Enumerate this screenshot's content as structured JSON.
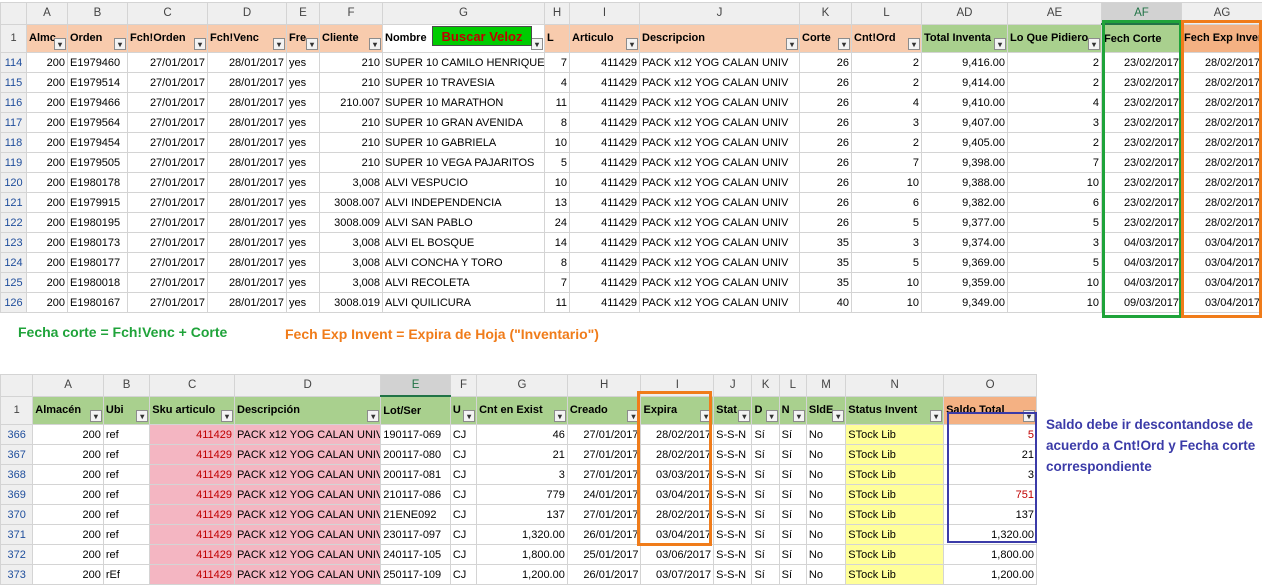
{
  "sheet1": {
    "col_letters": [
      "",
      "A",
      "B",
      "C",
      "D",
      "E",
      "F",
      "G",
      "H",
      "I",
      "J",
      "K",
      "L",
      "AD",
      "AE",
      "AF",
      "AG"
    ],
    "header_row_number": "1",
    "headers": [
      "Almc",
      "Orden",
      "Fch!Orden",
      "Fch!Venc",
      "Fre",
      "Cliente",
      "Nombre",
      "L",
      "Articulo",
      "Descripcion",
      "Corte",
      "Cnt!Ord",
      "Total Inventa",
      "Lo Que Pidiero",
      "Fech Corte",
      "Fech Exp Inven"
    ],
    "button_label": "Buscar Veloz",
    "rows": [
      {
        "n": "114",
        "cells": [
          "200",
          "E1979460",
          "27/01/2017",
          "28/01/2017",
          "yes",
          "210",
          "SUPER 10 CAMILO HENRIQUEZ V",
          "7",
          "411429",
          "PACK x12 YOG CALAN UNIV",
          "26",
          "2",
          "9,416.00",
          "2",
          "23/02/2017",
          "28/02/2017"
        ]
      },
      {
        "n": "115",
        "cells": [
          "200",
          "E1979514",
          "27/01/2017",
          "28/01/2017",
          "yes",
          "210",
          "SUPER 10 TRAVESIA",
          "4",
          "411429",
          "PACK x12 YOG CALAN UNIV",
          "26",
          "2",
          "9,414.00",
          "2",
          "23/02/2017",
          "28/02/2017"
        ]
      },
      {
        "n": "116",
        "cells": [
          "200",
          "E1979466",
          "27/01/2017",
          "28/01/2017",
          "yes",
          "210.007",
          "SUPER 10 MARATHON",
          "11",
          "411429",
          "PACK x12 YOG CALAN UNIV",
          "26",
          "4",
          "9,410.00",
          "4",
          "23/02/2017",
          "28/02/2017"
        ]
      },
      {
        "n": "117",
        "cells": [
          "200",
          "E1979564",
          "27/01/2017",
          "28/01/2017",
          "yes",
          "210",
          "SUPER 10 GRAN AVENIDA",
          "8",
          "411429",
          "PACK x12 YOG CALAN UNIV",
          "26",
          "3",
          "9,407.00",
          "3",
          "23/02/2017",
          "28/02/2017"
        ]
      },
      {
        "n": "118",
        "cells": [
          "200",
          "E1979454",
          "27/01/2017",
          "28/01/2017",
          "yes",
          "210",
          "SUPER 10 GABRIELA",
          "10",
          "411429",
          "PACK x12 YOG CALAN UNIV",
          "26",
          "2",
          "9,405.00",
          "2",
          "23/02/2017",
          "28/02/2017"
        ]
      },
      {
        "n": "119",
        "cells": [
          "200",
          "E1979505",
          "27/01/2017",
          "28/01/2017",
          "yes",
          "210",
          "SUPER 10 VEGA PAJARITOS",
          "5",
          "411429",
          "PACK x12 YOG CALAN UNIV",
          "26",
          "7",
          "9,398.00",
          "7",
          "23/02/2017",
          "28/02/2017"
        ]
      },
      {
        "n": "120",
        "cells": [
          "200",
          "E1980178",
          "27/01/2017",
          "28/01/2017",
          "yes",
          "3,008",
          "ALVI VESPUCIO",
          "10",
          "411429",
          "PACK x12 YOG CALAN UNIV",
          "26",
          "10",
          "9,388.00",
          "10",
          "23/02/2017",
          "28/02/2017"
        ]
      },
      {
        "n": "121",
        "cells": [
          "200",
          "E1979915",
          "27/01/2017",
          "28/01/2017",
          "yes",
          "3008.007",
          "ALVI INDEPENDENCIA",
          "13",
          "411429",
          "PACK x12 YOG CALAN UNIV",
          "26",
          "6",
          "9,382.00",
          "6",
          "23/02/2017",
          "28/02/2017"
        ]
      },
      {
        "n": "122",
        "cells": [
          "200",
          "E1980195",
          "27/01/2017",
          "28/01/2017",
          "yes",
          "3008.009",
          "ALVI SAN PABLO",
          "24",
          "411429",
          "PACK x12 YOG CALAN UNIV",
          "26",
          "5",
          "9,377.00",
          "5",
          "23/02/2017",
          "28/02/2017"
        ]
      },
      {
        "n": "123",
        "cells": [
          "200",
          "E1980173",
          "27/01/2017",
          "28/01/2017",
          "yes",
          "3,008",
          "ALVI EL BOSQUE",
          "14",
          "411429",
          "PACK x12 YOG CALAN UNIV",
          "35",
          "3",
          "9,374.00",
          "3",
          "04/03/2017",
          "03/04/2017"
        ]
      },
      {
        "n": "124",
        "cells": [
          "200",
          "E1980177",
          "27/01/2017",
          "28/01/2017",
          "yes",
          "3,008",
          "ALVI CONCHA Y TORO",
          "8",
          "411429",
          "PACK x12 YOG CALAN UNIV",
          "35",
          "5",
          "9,369.00",
          "5",
          "04/03/2017",
          "03/04/2017"
        ]
      },
      {
        "n": "125",
        "cells": [
          "200",
          "E1980018",
          "27/01/2017",
          "28/01/2017",
          "yes",
          "3,008",
          "ALVI RECOLETA",
          "7",
          "411429",
          "PACK x12 YOG CALAN UNIV",
          "35",
          "10",
          "9,359.00",
          "10",
          "04/03/2017",
          "03/04/2017"
        ]
      },
      {
        "n": "126",
        "cells": [
          "200",
          "E1980167",
          "27/01/2017",
          "28/01/2017",
          "yes",
          "3008.019",
          "ALVI QUILICURA",
          "11",
          "411429",
          "PACK x12 YOG CALAN UNIV",
          "40",
          "10",
          "9,349.00",
          "10",
          "09/03/2017",
          "03/04/2017"
        ]
      }
    ]
  },
  "notes": {
    "fecha_corte": "Fecha corte = Fch!Venc + Corte",
    "fech_exp": "Fech Exp Invent = Expira de Hoja (\"Inventario\")",
    "saldo": "Saldo debe ir descontandose de acuerdo a Cnt!Ord y Fecha corte correspondiente"
  },
  "sheet2": {
    "col_letters": [
      "",
      "A",
      "B",
      "C",
      "D",
      "E",
      "F",
      "G",
      "H",
      "I",
      "J",
      "K",
      "L",
      "M",
      "N",
      "O"
    ],
    "header_row_number": "1",
    "headers": [
      "Almacén",
      "Ubi",
      "Sku articulo",
      "Descripción",
      "Lot/Ser",
      "U",
      "Cnt en Exist",
      "Creado",
      "Expira",
      "Stat",
      "D",
      "N",
      "SldE",
      "Status Invent",
      "Saldo Total"
    ],
    "rows": [
      {
        "n": "366",
        "cells": [
          "200",
          "ref",
          "411429",
          "PACK x12 YOG CALAN UNIV",
          "190117-069",
          "CJ",
          "46",
          "27/01/2017",
          "28/02/2017",
          "S-S-N",
          "Sí",
          "Sí",
          "No",
          "STock Lib",
          "5"
        ]
      },
      {
        "n": "367",
        "cells": [
          "200",
          "ref",
          "411429",
          "PACK x12 YOG CALAN UNIV",
          "200117-080",
          "CJ",
          "21",
          "27/01/2017",
          "28/02/2017",
          "S-S-N",
          "Sí",
          "Sí",
          "No",
          "STock Lib",
          "21"
        ]
      },
      {
        "n": "368",
        "cells": [
          "200",
          "ref",
          "411429",
          "PACK x12 YOG CALAN UNIV",
          "200117-081",
          "CJ",
          "3",
          "27/01/2017",
          "03/03/2017",
          "S-S-N",
          "Sí",
          "Sí",
          "No",
          "STock Lib",
          "3"
        ]
      },
      {
        "n": "369",
        "cells": [
          "200",
          "ref",
          "411429",
          "PACK x12 YOG CALAN UNIV",
          "210117-086",
          "CJ",
          "779",
          "24/01/2017",
          "03/04/2017",
          "S-S-N",
          "Sí",
          "Sí",
          "No",
          "STock Lib",
          "751"
        ]
      },
      {
        "n": "370",
        "cells": [
          "200",
          "ref",
          "411429",
          "PACK x12 YOG CALAN UNIV",
          "21ENE092",
          "CJ",
          "137",
          "27/01/2017",
          "28/02/2017",
          "S-S-N",
          "Sí",
          "Sí",
          "No",
          "STock Lib",
          "137"
        ]
      },
      {
        "n": "371",
        "cells": [
          "200",
          "ref",
          "411429",
          "PACK x12 YOG CALAN UNIV",
          "230117-097",
          "CJ",
          "1,320.00",
          "26/01/2017",
          "03/04/2017",
          "S-S-N",
          "Sí",
          "Sí",
          "No",
          "STock Lib",
          "1,320.00"
        ]
      },
      {
        "n": "372",
        "cells": [
          "200",
          "ref",
          "411429",
          "PACK x12 YOG CALAN UNIV",
          "240117-105",
          "CJ",
          "1,800.00",
          "25/01/2017",
          "03/06/2017",
          "S-S-N",
          "Sí",
          "Sí",
          "No",
          "STock Lib",
          "1,800.00"
        ]
      },
      {
        "n": "373",
        "cells": [
          "200",
          "rEf",
          "411429",
          "PACK x12 YOG CALAN UNIV",
          "250117-109",
          "CJ",
          "1,200.00",
          "26/01/2017",
          "03/07/2017",
          "S-S-N",
          "Sí",
          "Sí",
          "No",
          "STock Lib",
          "1,200.00"
        ]
      }
    ]
  },
  "colors": {
    "header_salmon": "#f8cbad",
    "header_green": "#a9d08e",
    "box_green": "#1fa33a",
    "box_orange": "#f07c1a",
    "box_blue": "#3b3ba8",
    "note_green": "#1fa33a",
    "note_orange": "#f07c1a",
    "note_blue": "#3b3ba8",
    "button_bg": "#00cc00"
  }
}
